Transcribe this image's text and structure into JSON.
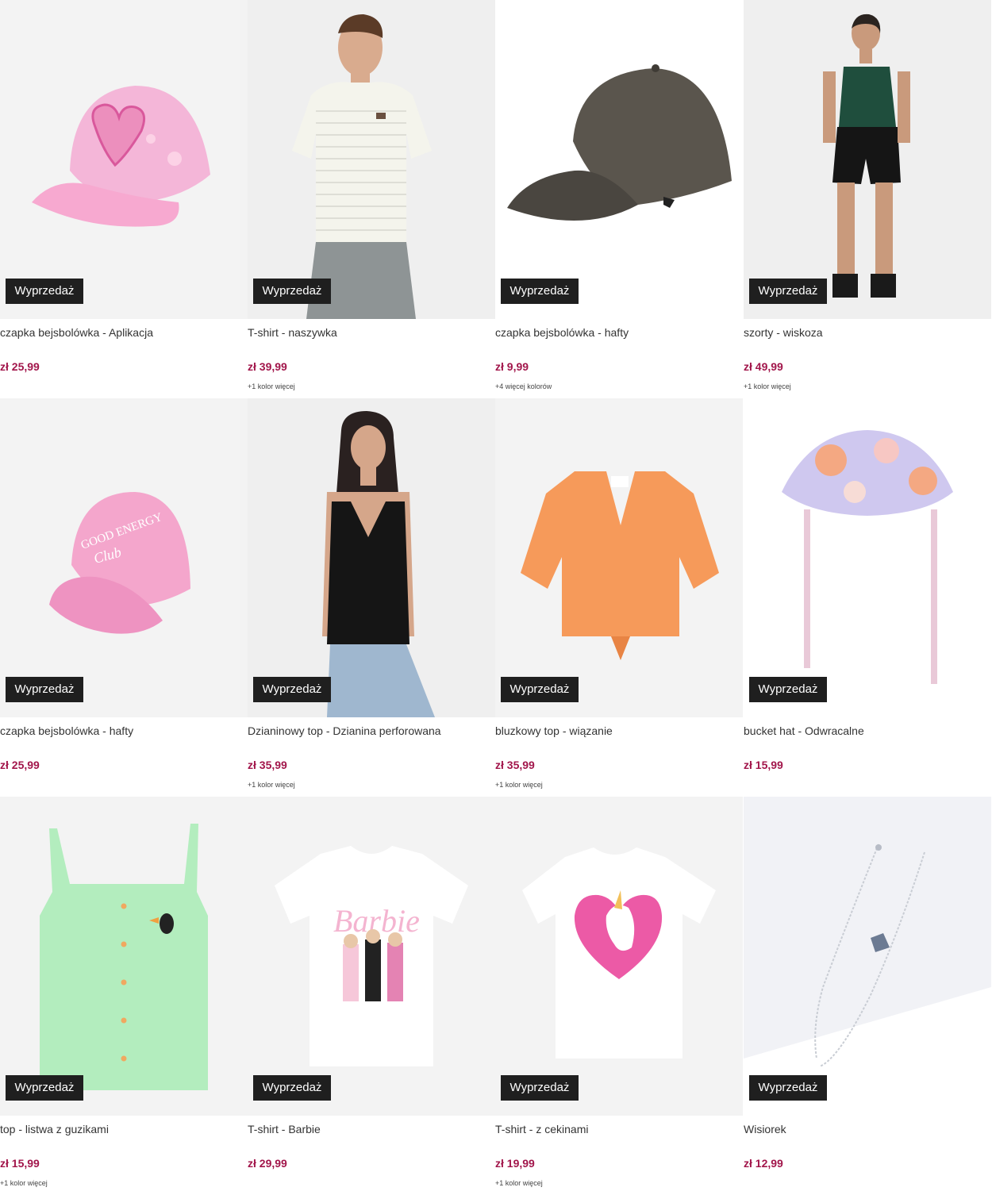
{
  "badge_label": "Wyprzedaż",
  "colors": {
    "price": "#a2164b",
    "badge_bg": "#1f1f1f",
    "photo_bg": "#f2f2f2"
  },
  "products": [
    {
      "title": "czapka bejsbolówka - Aplikacja",
      "price": "zł 25,99",
      "more_colors": "",
      "image": "pink-cap-heart-icon"
    },
    {
      "title": "T-shirt - naszywka",
      "price": "zł 39,99",
      "more_colors": "+1 kolor więcej",
      "image": "striped-tshirt-model-icon"
    },
    {
      "title": "czapka bejsbolówka - hafty",
      "price": "zł 9,99",
      "more_colors": "+4 więcej kolorów",
      "image": "khaki-cap-icon"
    },
    {
      "title": "szorty - wiskoza",
      "price": "zł 49,99",
      "more_colors": "+1 kolor więcej",
      "image": "black-shorts-model-icon"
    },
    {
      "title": "czapka bejsbolówka - hafty",
      "price": "zł 25,99",
      "more_colors": "",
      "image": "pink-cap-club-icon"
    },
    {
      "title": "Dzianinowy top - Dzianina perforowana",
      "price": "zł 35,99",
      "more_colors": "+1 kolor więcej",
      "image": "black-knit-top-model-icon"
    },
    {
      "title": "bluzkowy top - wiązanie",
      "price": "zł 35,99",
      "more_colors": "+1 kolor więcej",
      "image": "orange-tie-top-icon"
    },
    {
      "title": "bucket hat - Odwracalne",
      "price": "zł 15,99",
      "more_colors": "",
      "image": "floral-bucket-hat-icon"
    },
    {
      "title": "top - listwa z guzikami",
      "price": "zł 15,99",
      "more_colors": "+1 kolor więcej",
      "image": "green-button-top-icon"
    },
    {
      "title": "T-shirt - Barbie",
      "price": "zł 29,99",
      "more_colors": "",
      "image": "barbie-tshirt-icon"
    },
    {
      "title": "T-shirt - z cekinami",
      "price": "zł 19,99",
      "more_colors": "+1 kolor więcej",
      "image": "unicorn-tshirt-icon"
    },
    {
      "title": "Wisiorek",
      "price": "zł 12,99",
      "more_colors": "",
      "image": "silver-necklace-icon"
    }
  ]
}
